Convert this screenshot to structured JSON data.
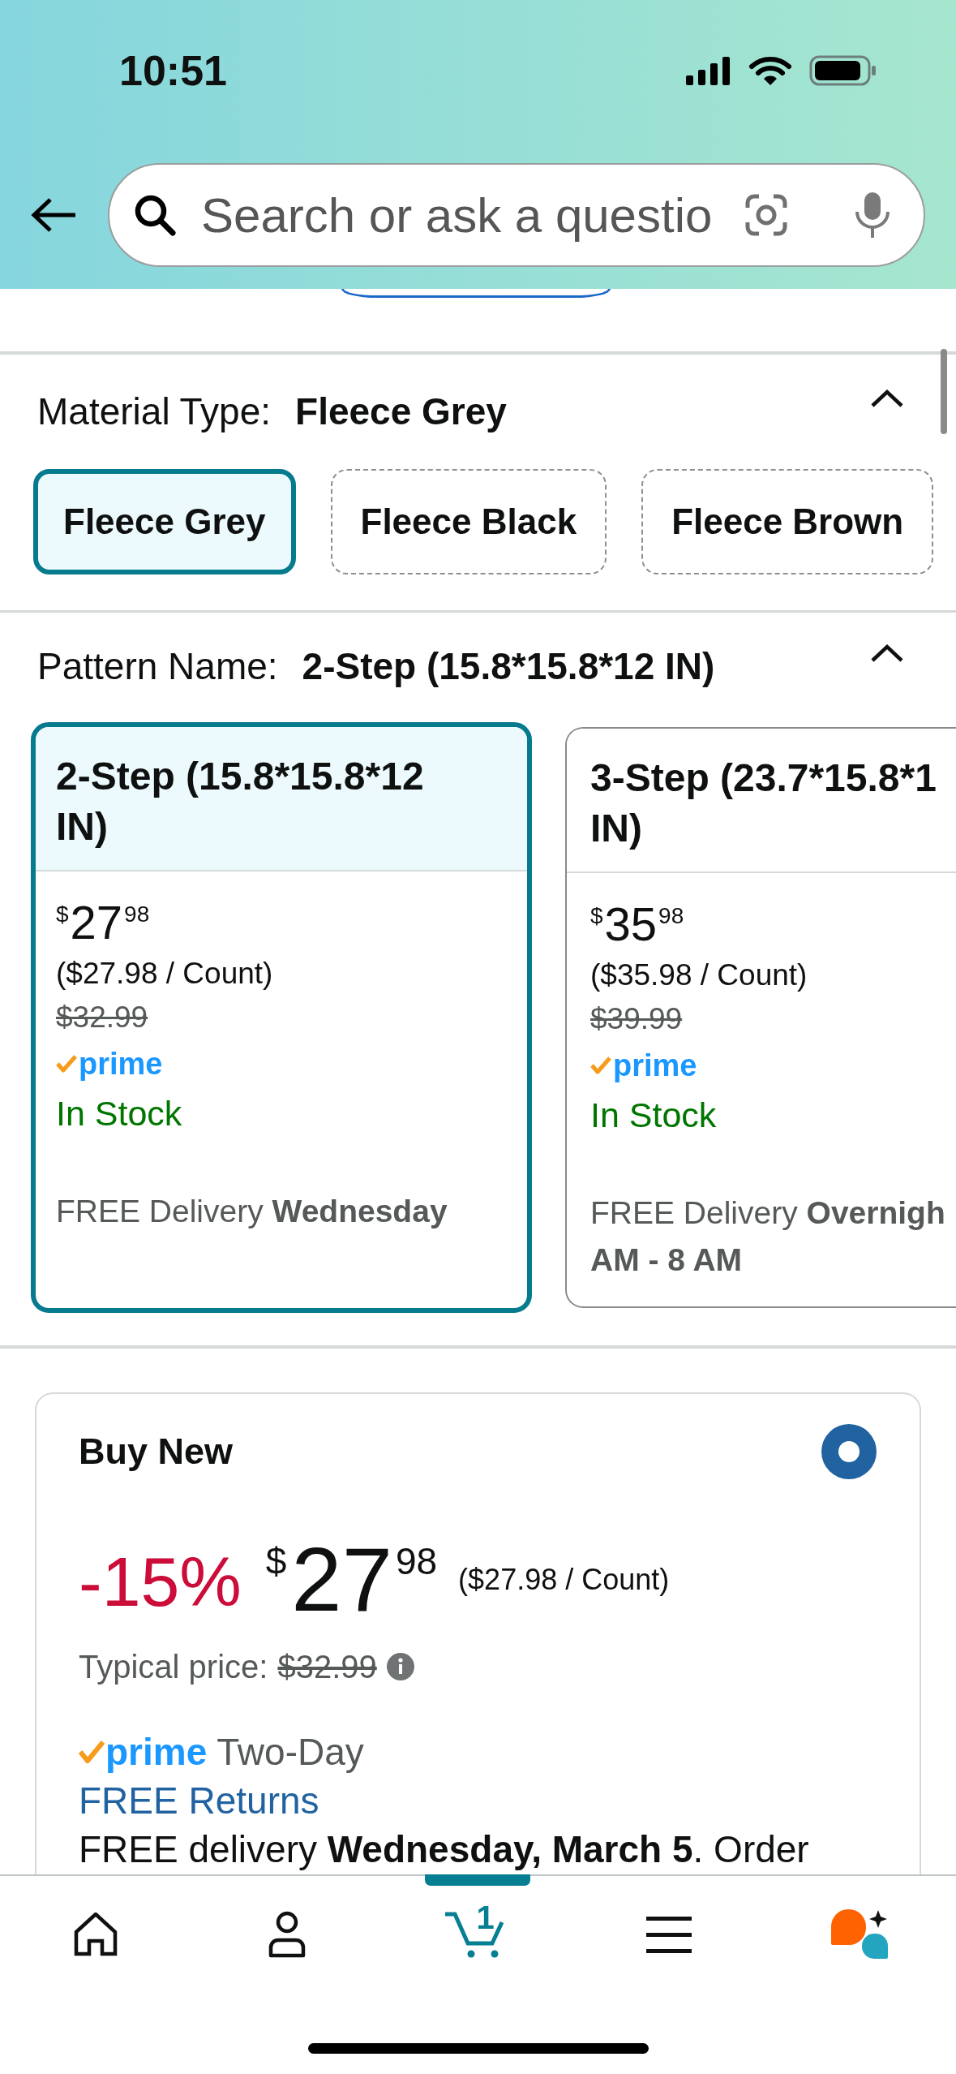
{
  "status_bar": {
    "time": "10:51"
  },
  "search_bar": {
    "placeholder": "Search or ask a questio"
  },
  "material_type": {
    "label": "Material Type:",
    "value": "Fleece Grey",
    "expanded": true,
    "options": [
      {
        "label": "Fleece Grey",
        "selected": true
      },
      {
        "label": "Fleece Black",
        "selected": false
      },
      {
        "label": "Fleece Brown",
        "selected": false
      }
    ]
  },
  "pattern_name": {
    "label": "Pattern Name:",
    "value": "2-Step (15.8*15.8*12 IN)",
    "expanded": true,
    "options": [
      {
        "title_lines": [
          "2-Step (15.8*15.8*12",
          "IN)"
        ],
        "selected": true,
        "price": {
          "symbol": "$",
          "whole": "27",
          "fraction": "98"
        },
        "unit_price": "($27.98 / Count)",
        "list_price": "$32.99",
        "prime": "prime",
        "availability": "In Stock",
        "delivery_lines": [
          "FREE Delivery **Wednesday**"
        ]
      },
      {
        "title_lines": [
          "3-Step (23.7*15.8*1",
          "IN)"
        ],
        "selected": false,
        "price": {
          "symbol": "$",
          "whole": "35",
          "fraction": "98"
        },
        "unit_price": "($35.98 / Count)",
        "list_price": "$39.99",
        "prime": "prime",
        "availability": "In Stock",
        "delivery_lines": [
          "FREE Delivery **Overnigh**",
          "**AM - 8 AM**"
        ]
      }
    ]
  },
  "buy_new": {
    "title": "Buy New",
    "selected": true,
    "discount": "-15%",
    "price": {
      "symbol": "$",
      "whole": "27",
      "fraction": "98"
    },
    "unit_price": "($27.98 / Count)",
    "typical_price_label": "Typical price:",
    "typical_price": "$32.99",
    "prime": "prime",
    "shipping_speed": "Two-Day",
    "returns_link": "FREE Returns",
    "delivery": "FREE delivery **Wednesday, March 5**. Order"
  },
  "bottom_nav": [
    {
      "kind": "home",
      "selected": false
    },
    {
      "kind": "account",
      "selected": false
    },
    {
      "kind": "cart",
      "selected": true,
      "count": "1"
    },
    {
      "kind": "menu",
      "selected": false
    },
    {
      "kind": "assistant",
      "selected": false
    }
  ]
}
